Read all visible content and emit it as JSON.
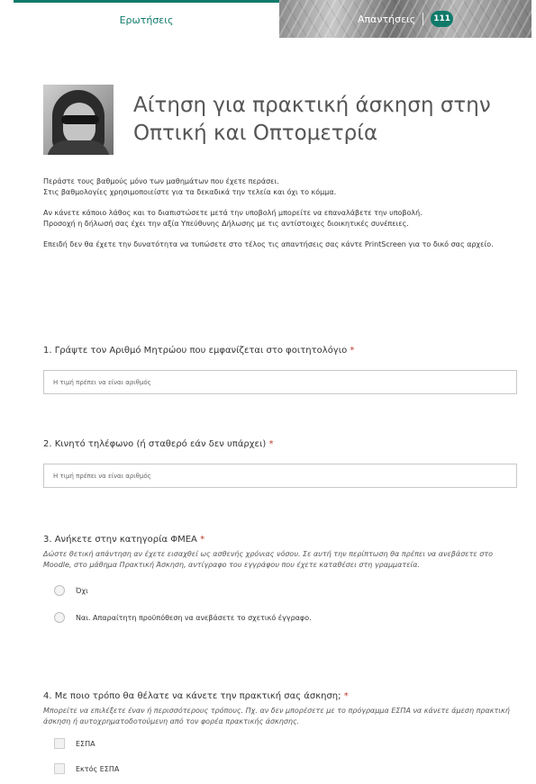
{
  "tabs": {
    "questions_label": "Ερωτήσεις",
    "responses_label": "Απαντήσεις",
    "responses_count": "111"
  },
  "form": {
    "title": "Αίτηση για πρακτική άσκηση στην Οπτική και Οπτομετρία",
    "description": [
      "Περάστε τους βαθμούς μόνο των μαθημάτων που έχετε περάσει.",
      "Στις βαθμολογίες χρησιμοποιείστε για τα δεκαδικά την τελεία και όχι το κόμμα.",
      "Αν κάνετε κάποιο λάθος και το διαπιστώσετε μετά την υποβολή μπορείτε να επαναλάβετε την υποβολή.",
      "Προσοχή η δήλωσή σας έχει την αξία Υπεύθυνης Δήλωσης με τις αντίστοιχες διοικητικές συνέπειες.",
      "Επειδή δεν θα έχετε την δυνατότητα να τυπώσετε στο τέλος τις απαντήσεις σας κάντε PrintScreen για το δικό σας αρχείο."
    ]
  },
  "questions": [
    {
      "title": "1. Γράψτε τον Αριθμό Μητρώου που εμφανίζεται στο φοιτητολόγιο",
      "required_mark": "*",
      "placeholder": "Η τιμή πρέπει να είναι αριθμός"
    },
    {
      "title": "2. Κινητό τηλέφωνο (ή σταθερό εάν δεν υπάρχει)",
      "required_mark": "*",
      "placeholder": "Η τιμή πρέπει να είναι αριθμός"
    },
    {
      "title": "3. Ανήκετε στην κατηγορία ΦΜΕΑ",
      "required_mark": "*",
      "hint": "Δώστε θετική απάντηση αν έχετε εισαχθεί ως ασθενής χρόνιας νόσου. Σε αυτή την περίπτωση θα πρέπει να ανεβάσετε στο Moodle, στο μάθημα Πρακτική Άσκηση, αντίγραφο του εγγράφου που έχετε καταθέσει στη γραμματεία.",
      "options": [
        "Όχι",
        "Ναι. Απαραίτητη προϋπόθεση να ανεβάσετε το σχετικό έγγραφο."
      ]
    },
    {
      "title": "4. Με ποιο τρόπο θα θέλατε να κάνετε την πρακτική σας άσκηση;",
      "required_mark": "*",
      "hint": "Μπορείτε να επιλέξετε έναν ή περισσότερους τρόπους. Πχ. αν δεν μπορέσετε με το πρόγραμμα ΕΣΠΑ να κάνετε άμεση πρακτική άσκηση ή αυτοχρηματοδοτούμενη από τον φορέα πρακτικής άσκησης.",
      "options": [
        "ΕΣΠΑ",
        "Εκτός ΕΣΠΑ"
      ]
    }
  ],
  "colors": {
    "accent": "#0f7a6a",
    "required": "#c0392b"
  }
}
